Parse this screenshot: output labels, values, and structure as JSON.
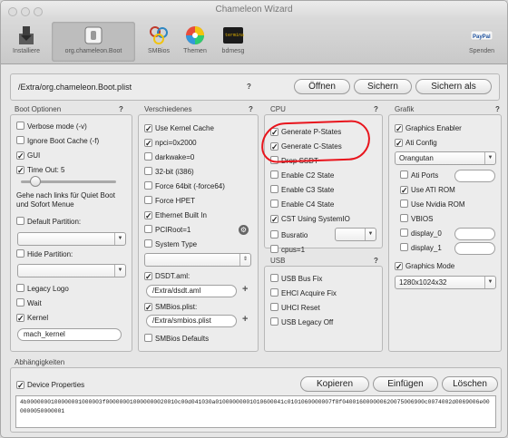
{
  "window": {
    "title": "Chameleon Wizard"
  },
  "toolbar": {
    "items": [
      {
        "label": "Installiere",
        "icon": "installer-icon"
      },
      {
        "label": "org.chameleon.Boot",
        "icon": "switch-icon"
      },
      {
        "label": "SMBios",
        "icon": "molecule-icon"
      },
      {
        "label": "Themen",
        "icon": "color-wheel-icon"
      },
      {
        "label": "bdmesg",
        "icon": "console-icon"
      },
      {
        "label": "Spenden",
        "icon": "paypal-icon"
      }
    ],
    "paypal_text": "PayPal",
    "console_text": "terminal"
  },
  "path_bar": {
    "path": "/Extra/org.chameleon.Boot.plist",
    "help": "?",
    "open_label": "Öffnen",
    "save_label": "Sichern",
    "save_as_label": "Sichern als"
  },
  "boot_options": {
    "title": "Boot Optionen",
    "help": "?",
    "verbose": "Verbose mode (-v)",
    "ignore_cache": "Ignore Boot Cache (-f)",
    "gui": "GUI",
    "timeout": "Time Out: 5",
    "slider_value": 0.15,
    "note": "Gehe nach links für Quiet Boot und Sofort Menue",
    "default_partition": "Default Partition:",
    "hide_partition": "Hide Partition:",
    "legacy_logo": "Legacy Logo",
    "wait": "Wait",
    "kernel": "Kernel",
    "kernel_value": "mach_kernel"
  },
  "misc": {
    "title": "Verschiedenes",
    "help": "?",
    "use_kernel_cache": "Use Kernel Cache",
    "npci": "npci=0x2000",
    "darkwake": "darkwake=0",
    "bit32": "32-bit (i386)",
    "force64": "Force 64bit (-force64)",
    "force_hpet": "Force HPET",
    "ethernet": "Ethernet Built In",
    "pciroot": "PCIRoot=1",
    "system_type": "System Type",
    "dsdt": "DSDT.aml:",
    "dsdt_path": "/Extra/dsdt.aml",
    "smbios": "SMBios.plist:",
    "smbios_path": "/Extra/smbios.plist",
    "smbios_defaults": "SMBios Defaults",
    "plus": "+"
  },
  "cpu": {
    "title": "CPU",
    "help": "?",
    "gen_p": "Generate P-States",
    "gen_c": "Generate C-States",
    "drop_ssdt": "Drop SSDT",
    "c2": "Enable C2 State",
    "c3": "Enable C3 State",
    "c4": "Enable C4 State",
    "cst": "CST Using SystemIO",
    "busratio": "Busratio",
    "cpus": "cpus=1"
  },
  "usb": {
    "title": "USB",
    "help": "?",
    "busfix": "USB Bus Fix",
    "ehci": "EHCI Acquire Fix",
    "uhci": "UHCI Reset",
    "legacy": "USB Legacy Off"
  },
  "graphics": {
    "title": "Grafik",
    "help": "?",
    "enabler": "Graphics Enabler",
    "ati_config": "Ati Config",
    "ati_value": "Orangutan",
    "ati_ports": "Ati Ports",
    "use_ati_rom": "Use ATI ROM",
    "use_nvidia_rom": "Use Nvidia ROM",
    "vbios": "VBIOS",
    "display0": "display_0",
    "display1": "display_1",
    "graphics_mode": "Graphics Mode",
    "mode_value": "1280x1024x32"
  },
  "deps": {
    "title": "Abhängigkeiten",
    "device_props": "Device Properties",
    "copy_label": "Kopieren",
    "paste_label": "Einfügen",
    "delete_label": "Löschen",
    "hex": "4b0000000100000001000003f000000010000000020010c00d041030a01000000001010600041c0101060000007f8f040016000000620075006900c0074002d0069006e000000050000001"
  },
  "checkmark": "✓",
  "annotation_color": "#e8141c"
}
